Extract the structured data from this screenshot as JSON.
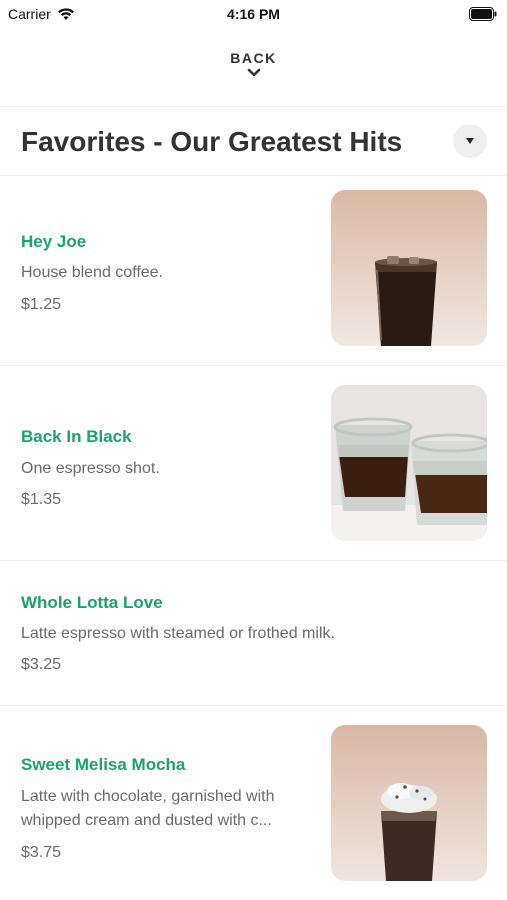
{
  "status_bar": {
    "carrier": "Carrier",
    "time": "4:16 PM"
  },
  "nav": {
    "back_label": "BACK"
  },
  "header": {
    "title": "Favorites - Our Greatest Hits"
  },
  "items": [
    {
      "name": "Hey Joe",
      "description": "House blend coffee.",
      "price": "$1.25",
      "image": "iced-coffee-glass"
    },
    {
      "name": "Back In Black",
      "description": "One espresso shot.",
      "price": "$1.35",
      "image": "espresso-shot-glasses"
    },
    {
      "name": "Whole Lotta Love",
      "description": "Latte espresso with steamed or frothed milk.",
      "price": "$3.25",
      "image": ""
    },
    {
      "name": "Sweet Melisa Mocha",
      "description_line1": "Latte with chocolate, garnished with",
      "description_line2": "whipped cream and dusted with c...",
      "price": "$3.75",
      "image": "mocha-with-whipped-cream"
    }
  ],
  "colors": {
    "accent": "#1aa46b",
    "text": "#333333",
    "muted": "#6b6b6b",
    "divider": "#ececec"
  }
}
